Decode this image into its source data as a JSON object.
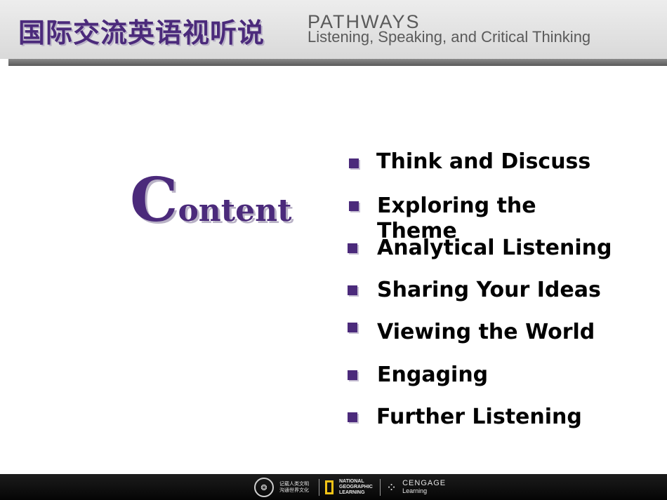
{
  "header": {
    "cn_title": "国际交流英语视听说",
    "brand": "PATHWAYS",
    "tagline": "Listening, Speaking, and Critical Thinking"
  },
  "heading": {
    "first_letter": "C",
    "rest": "ontent"
  },
  "menu": {
    "items": [
      {
        "label": "Think and Discuss"
      },
      {
        "label": "Exploring the Theme"
      },
      {
        "label": "Analytical Listening"
      },
      {
        "label": "Sharing Your Ideas"
      },
      {
        "label": "Viewing the World"
      },
      {
        "label": "Engaging"
      },
      {
        "label": "Further Listening"
      }
    ]
  },
  "footer": {
    "seal_text": "记载人类文明 沟通世界文化",
    "ng_text": "NATIONAL GEOGRAPHIC LEARNING",
    "cengage_name": "CENGAGE",
    "cengage_sub": "Learning"
  },
  "colors": {
    "accent": "#4b2a7b",
    "shadow": "#b9b2c6",
    "header_bg": "#e3e3e3",
    "footer_bg": "#111111"
  }
}
